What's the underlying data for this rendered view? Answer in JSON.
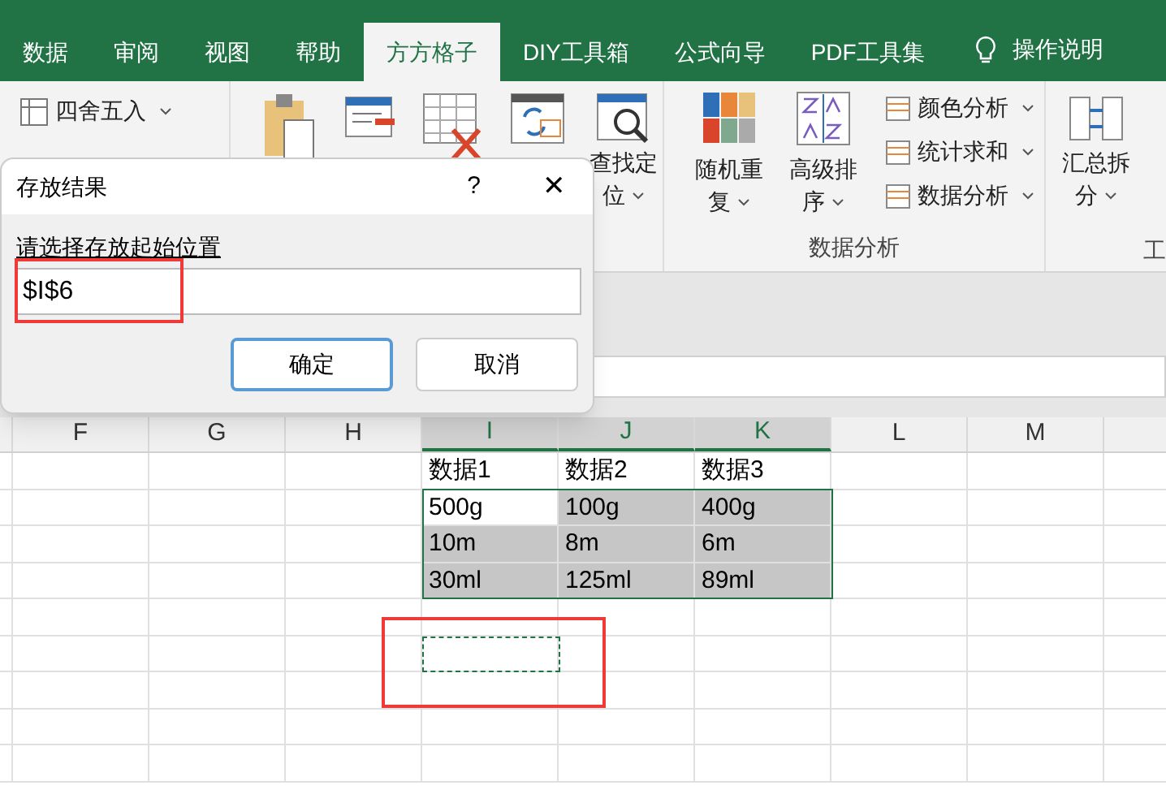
{
  "ribbon_tabs": [
    {
      "label": "数据",
      "selected": false
    },
    {
      "label": "审阅",
      "selected": false
    },
    {
      "label": "视图",
      "selected": false
    },
    {
      "label": "帮助",
      "selected": false
    },
    {
      "label": "方方格子",
      "selected": true
    },
    {
      "label": "DIY工具箱",
      "selected": false
    },
    {
      "label": "公式向导",
      "selected": false
    },
    {
      "label": "PDF工具集",
      "selected": false
    }
  ],
  "tell_me": {
    "label": "操作说明"
  },
  "ribbon": {
    "small_items": [
      {
        "label": "四舍五入"
      }
    ],
    "find_label": [
      "查找定",
      "位"
    ],
    "big_buttons": [
      {
        "lines": [
          "随机重",
          "复"
        ]
      },
      {
        "lines": [
          "高级排",
          "序"
        ]
      }
    ],
    "list_items": [
      {
        "label": "颜色分析"
      },
      {
        "label": "统计求和"
      },
      {
        "label": "数据分析"
      }
    ],
    "group_label": "数据分析",
    "split_button": {
      "lines": [
        "汇总拆",
        "分"
      ]
    },
    "cut_label": "工"
  },
  "dialog": {
    "title": "存放结果",
    "help": "?",
    "close": "✕",
    "prompt": "请选择存放起始位置",
    "value": "$I$6",
    "buttons": [
      {
        "label": "确定",
        "default": true
      },
      {
        "label": "取消",
        "default": false
      }
    ]
  },
  "sheet": {
    "columns": [
      {
        "label": "F",
        "selected": false
      },
      {
        "label": "G",
        "selected": false
      },
      {
        "label": "H",
        "selected": false
      },
      {
        "label": "I",
        "selected": true
      },
      {
        "label": "J",
        "selected": true
      },
      {
        "label": "K",
        "selected": true
      },
      {
        "label": "L",
        "selected": false
      },
      {
        "label": "M",
        "selected": false
      }
    ],
    "rows": [
      [
        {
          "text": "数据1",
          "selected": false
        },
        {
          "text": "数据2",
          "selected": false
        },
        {
          "text": "数据3",
          "selected": false
        }
      ],
      [
        {
          "text": "500g",
          "selected": false
        },
        {
          "text": "100g",
          "selected": true
        },
        {
          "text": "400g",
          "selected": true
        }
      ],
      [
        {
          "text": "10m",
          "selected": true
        },
        {
          "text": "8m",
          "selected": true
        },
        {
          "text": "6m",
          "selected": true
        }
      ],
      [
        {
          "text": "30ml",
          "selected": true
        },
        {
          "text": "125ml",
          "selected": true
        },
        {
          "text": "89ml",
          "selected": true
        }
      ]
    ]
  }
}
